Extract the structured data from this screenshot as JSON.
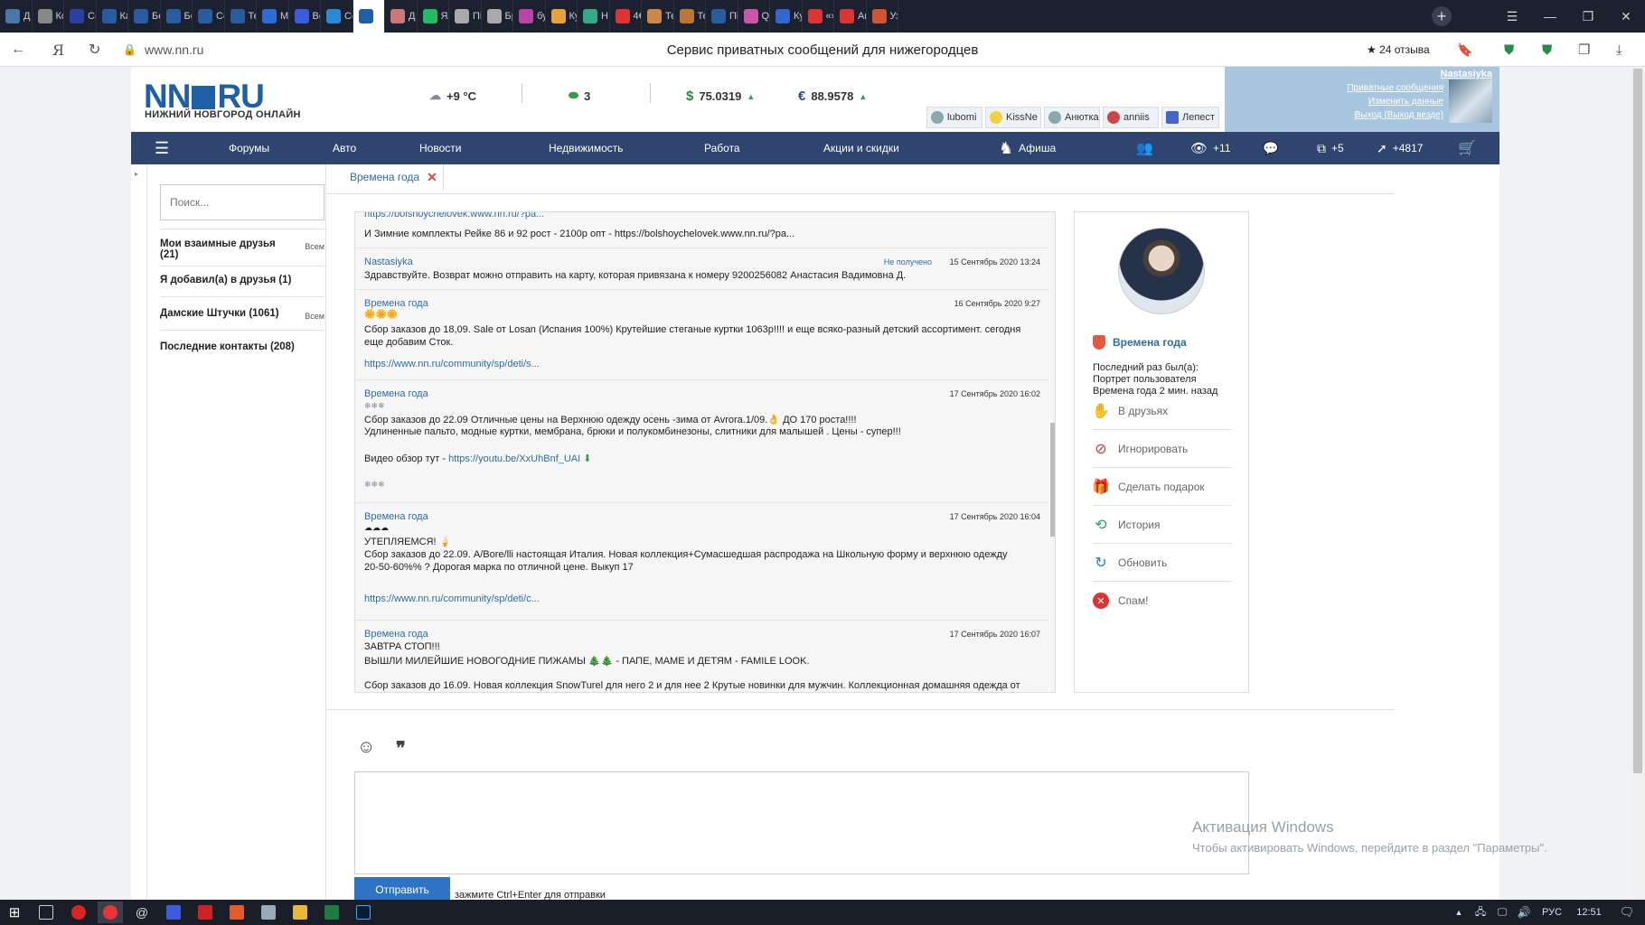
{
  "browser": {
    "tabs": [
      {
        "label": "Д",
        "color": "#4a76a8"
      },
      {
        "label": "Кс",
        "color": "#888"
      },
      {
        "label": "С(",
        "color": "#2a3fa0"
      },
      {
        "label": "Ка",
        "color": "#2a5aa0"
      },
      {
        "label": "Бе",
        "color": "#2a5aa0"
      },
      {
        "label": "Бе",
        "color": "#2a5aa0"
      },
      {
        "label": "Сс",
        "color": "#2a5aa0"
      },
      {
        "label": "Те",
        "color": "#2a5aa0"
      },
      {
        "label": "М",
        "color": "#2f6bd6"
      },
      {
        "label": "Вс",
        "color": "#3b5bdb"
      },
      {
        "label": "Сс",
        "color": "#2a8ad6"
      },
      {
        "label": "",
        "color": "#1f5fa8",
        "active": true
      },
      {
        "label": "Д",
        "color": "#c77"
      },
      {
        "label": "Ял",
        "color": "#2b6"
      },
      {
        "label": "Пі",
        "color": "#aaa"
      },
      {
        "label": "Бр",
        "color": "#aaa"
      },
      {
        "label": "бу",
        "color": "#b4a"
      },
      {
        "label": "Ку",
        "color": "#e8a23a"
      },
      {
        "label": "Н",
        "color": "#3a8"
      },
      {
        "label": "4€",
        "color": "#d33"
      },
      {
        "label": "Те",
        "color": "#c84"
      },
      {
        "label": "Те",
        "color": "#b73"
      },
      {
        "label": "Пі",
        "color": "#2a5aa0"
      },
      {
        "label": "Q",
        "color": "#c5a"
      },
      {
        "label": "Ку",
        "color": "#36c"
      },
      {
        "label": "«»",
        "color": "#d33"
      },
      {
        "label": "Ar",
        "color": "#d33"
      },
      {
        "label": "Уз",
        "color": "#c53"
      }
    ],
    "new_tab": "+",
    "url": "www.nn.ru",
    "page_title": "Сервис приватных сообщений для нижегородцев",
    "reviews": "★ 24 отзыва",
    "win_menu": "☰",
    "win_min": "—",
    "win_max": "❐",
    "win_close": "✕"
  },
  "header": {
    "logo_left": "NN",
    "logo_right": "RU",
    "logo_sub": "НИЖНИЙ НОВГОРОД ОНЛАЙН",
    "weather": "+9 °C",
    "traffic": "3",
    "usd": "75.0319",
    "eur": "88.9578",
    "user_name": "Nastasiyka",
    "user_links": [
      "Приватные сообщения",
      "Изменить данные",
      "Выход (Выход везде)"
    ],
    "online_users": [
      "lubomi",
      "KissNe",
      "Анютка",
      "anniis",
      "Лепест"
    ]
  },
  "nav": {
    "items": [
      "Форумы",
      "Авто",
      "Новости",
      "Недвижимость",
      "Работа",
      "Акции и скидки",
      "Афиша"
    ],
    "views": "+11",
    "stack": "+5",
    "rating": "+4817"
  },
  "sidebar": {
    "search_placeholder": "Поиск...",
    "groups": [
      {
        "label": "Мои взаимные друзья (21)",
        "all": "Всем"
      },
      {
        "label": "Я добавил(а) в друзья (1)",
        "all": ""
      },
      {
        "label": "Дамские Штучки (1061)",
        "all": "Всем"
      },
      {
        "label": "Последние контакты (208)",
        "all": ""
      }
    ]
  },
  "chat": {
    "tab_label": "Времена года",
    "messages": [
      {
        "author": "",
        "date": "",
        "status": "",
        "lines": [
          "И Зимние комплекты Рейке 86 и 92 рост - 2100р опт - https://bolshoychelovek.www.nn.ru/?pa..."
        ],
        "top_link": "https://bolshoychelovek.www.nn.ru/?pa..."
      },
      {
        "author": "Nastasiyka",
        "date": "15 Сентябрь 2020 13:24",
        "status": "Не получено",
        "lines": [
          "Здравствуйте. Возврат можно отправить на карту, которая привязана к номеру 9200256082 Анастасия Вадимовна Д."
        ]
      },
      {
        "author": "Времена года",
        "date": "16 Сентябрь 2020 9:27",
        "status": "",
        "lines": [
          "🌼🌼🌼",
          "Сбор заказов до 18,09. Sale от Losan (Испания 100%) Крутейшие стеганые куртки 1063р!!!! и еще всяко-разный детский ассортимент. сегодня",
          "еще добавим Сток."
        ],
        "link": "https://www.nn.ru/community/sp/deti/s..."
      },
      {
        "author": "Времена года",
        "date": "17 Сентябрь 2020 16:02",
        "status": "",
        "lines": [
          "❄❄❄",
          "Сбор заказов до 22.09 Отличные цены на Верхнюю одежду осень -зима от Avrora.1/09.👌 ДО 170 роста!!!!",
          "Удлиненные пальто, модные куртки, мембрана, брюки и полукомбинезоны, слитники для малышей . Цены - супер!!!",
          "Видео обзор тут - ",
          "❄❄❄"
        ],
        "link": "https://youtu.be/XxUhBnf_UAI"
      },
      {
        "author": "Времена года",
        "date": "17 Сентябрь 2020 16:04",
        "status": "",
        "lines": [
          "☁☁☁",
          "УТЕПЛЯЕМСЯ! 🍦",
          "Сбор заказов до 22.09. A/Bore/lli настоящая Италия. Новая коллекция+Сумасшедшая распродажа на Школьную форму и верхнюю одежду",
          "20-50-60%% ? Дорогая марка по отличной цене. Выкуп 17"
        ],
        "link": "https://www.nn.ru/community/sp/deti/c..."
      },
      {
        "author": "Времена года",
        "date": "17 Сентябрь 2020 16:07",
        "status": "",
        "lines": [
          "ЗАВТРА СТОП!!!",
          "ВЫШЛИ МИЛЕЙШИЕ НОВОГОДНИЕ ПИЖАМЫ 🎄🎄 - ПАПЕ, МАМЕ И ДЕТЯМ - FAMILE LOOK.",
          "Сбор заказов до 16.09. Новая коллекция SnowTurel для него 2 и для нее 2 Крутые новинки для мужчин. Коллекционная домашняя одежда от"
        ]
      }
    ]
  },
  "profile": {
    "name": "Времена года",
    "last_seen_label": "Последний раз был(а):",
    "last_seen_lines": [
      "Портрет пользователя",
      "Времена года 2 мин. назад"
    ],
    "actions": [
      "В друзьях",
      "Игнорировать",
      "Сделать подарок",
      "История",
      "Обновить",
      "Спам!"
    ]
  },
  "composer": {
    "send_label": "Отправить",
    "hint": "зажмите Ctrl+Enter для отправки"
  },
  "watermark": {
    "title": "Активация Windows",
    "subtitle": "Чтобы активировать Windows, перейдите в раздел \"Параметры\"."
  },
  "taskbar": {
    "lang": "РУС",
    "time": "12:51"
  }
}
